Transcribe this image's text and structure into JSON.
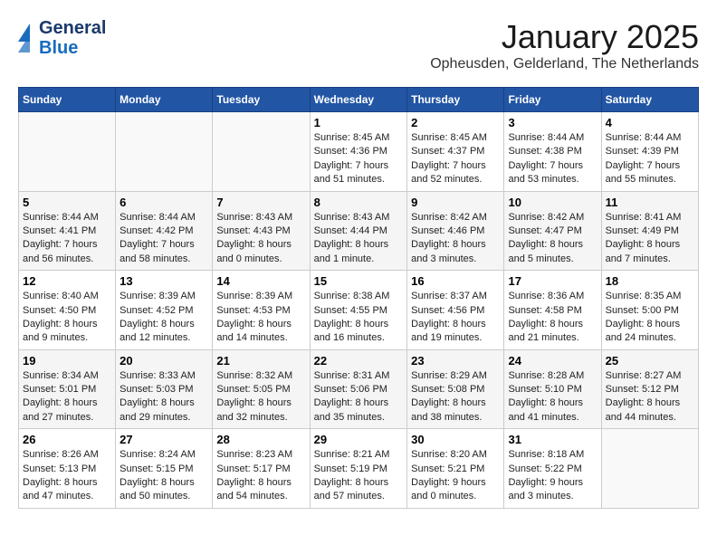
{
  "logo": {
    "line1": "General",
    "line2": "Blue"
  },
  "title": "January 2025",
  "subtitle": "Opheusden, Gelderland, The Netherlands",
  "weekdays": [
    "Sunday",
    "Monday",
    "Tuesday",
    "Wednesday",
    "Thursday",
    "Friday",
    "Saturday"
  ],
  "weeks": [
    [
      {
        "day": "",
        "info": ""
      },
      {
        "day": "",
        "info": ""
      },
      {
        "day": "",
        "info": ""
      },
      {
        "day": "1",
        "info": "Sunrise: 8:45 AM\nSunset: 4:36 PM\nDaylight: 7 hours and 51 minutes."
      },
      {
        "day": "2",
        "info": "Sunrise: 8:45 AM\nSunset: 4:37 PM\nDaylight: 7 hours and 52 minutes."
      },
      {
        "day": "3",
        "info": "Sunrise: 8:44 AM\nSunset: 4:38 PM\nDaylight: 7 hours and 53 minutes."
      },
      {
        "day": "4",
        "info": "Sunrise: 8:44 AM\nSunset: 4:39 PM\nDaylight: 7 hours and 55 minutes."
      }
    ],
    [
      {
        "day": "5",
        "info": "Sunrise: 8:44 AM\nSunset: 4:41 PM\nDaylight: 7 hours and 56 minutes."
      },
      {
        "day": "6",
        "info": "Sunrise: 8:44 AM\nSunset: 4:42 PM\nDaylight: 7 hours and 58 minutes."
      },
      {
        "day": "7",
        "info": "Sunrise: 8:43 AM\nSunset: 4:43 PM\nDaylight: 8 hours and 0 minutes."
      },
      {
        "day": "8",
        "info": "Sunrise: 8:43 AM\nSunset: 4:44 PM\nDaylight: 8 hours and 1 minute."
      },
      {
        "day": "9",
        "info": "Sunrise: 8:42 AM\nSunset: 4:46 PM\nDaylight: 8 hours and 3 minutes."
      },
      {
        "day": "10",
        "info": "Sunrise: 8:42 AM\nSunset: 4:47 PM\nDaylight: 8 hours and 5 minutes."
      },
      {
        "day": "11",
        "info": "Sunrise: 8:41 AM\nSunset: 4:49 PM\nDaylight: 8 hours and 7 minutes."
      }
    ],
    [
      {
        "day": "12",
        "info": "Sunrise: 8:40 AM\nSunset: 4:50 PM\nDaylight: 8 hours and 9 minutes."
      },
      {
        "day": "13",
        "info": "Sunrise: 8:39 AM\nSunset: 4:52 PM\nDaylight: 8 hours and 12 minutes."
      },
      {
        "day": "14",
        "info": "Sunrise: 8:39 AM\nSunset: 4:53 PM\nDaylight: 8 hours and 14 minutes."
      },
      {
        "day": "15",
        "info": "Sunrise: 8:38 AM\nSunset: 4:55 PM\nDaylight: 8 hours and 16 minutes."
      },
      {
        "day": "16",
        "info": "Sunrise: 8:37 AM\nSunset: 4:56 PM\nDaylight: 8 hours and 19 minutes."
      },
      {
        "day": "17",
        "info": "Sunrise: 8:36 AM\nSunset: 4:58 PM\nDaylight: 8 hours and 21 minutes."
      },
      {
        "day": "18",
        "info": "Sunrise: 8:35 AM\nSunset: 5:00 PM\nDaylight: 8 hours and 24 minutes."
      }
    ],
    [
      {
        "day": "19",
        "info": "Sunrise: 8:34 AM\nSunset: 5:01 PM\nDaylight: 8 hours and 27 minutes."
      },
      {
        "day": "20",
        "info": "Sunrise: 8:33 AM\nSunset: 5:03 PM\nDaylight: 8 hours and 29 minutes."
      },
      {
        "day": "21",
        "info": "Sunrise: 8:32 AM\nSunset: 5:05 PM\nDaylight: 8 hours and 32 minutes."
      },
      {
        "day": "22",
        "info": "Sunrise: 8:31 AM\nSunset: 5:06 PM\nDaylight: 8 hours and 35 minutes."
      },
      {
        "day": "23",
        "info": "Sunrise: 8:29 AM\nSunset: 5:08 PM\nDaylight: 8 hours and 38 minutes."
      },
      {
        "day": "24",
        "info": "Sunrise: 8:28 AM\nSunset: 5:10 PM\nDaylight: 8 hours and 41 minutes."
      },
      {
        "day": "25",
        "info": "Sunrise: 8:27 AM\nSunset: 5:12 PM\nDaylight: 8 hours and 44 minutes."
      }
    ],
    [
      {
        "day": "26",
        "info": "Sunrise: 8:26 AM\nSunset: 5:13 PM\nDaylight: 8 hours and 47 minutes."
      },
      {
        "day": "27",
        "info": "Sunrise: 8:24 AM\nSunset: 5:15 PM\nDaylight: 8 hours and 50 minutes."
      },
      {
        "day": "28",
        "info": "Sunrise: 8:23 AM\nSunset: 5:17 PM\nDaylight: 8 hours and 54 minutes."
      },
      {
        "day": "29",
        "info": "Sunrise: 8:21 AM\nSunset: 5:19 PM\nDaylight: 8 hours and 57 minutes."
      },
      {
        "day": "30",
        "info": "Sunrise: 8:20 AM\nSunset: 5:21 PM\nDaylight: 9 hours and 0 minutes."
      },
      {
        "day": "31",
        "info": "Sunrise: 8:18 AM\nSunset: 5:22 PM\nDaylight: 9 hours and 3 minutes."
      },
      {
        "day": "",
        "info": ""
      }
    ]
  ]
}
